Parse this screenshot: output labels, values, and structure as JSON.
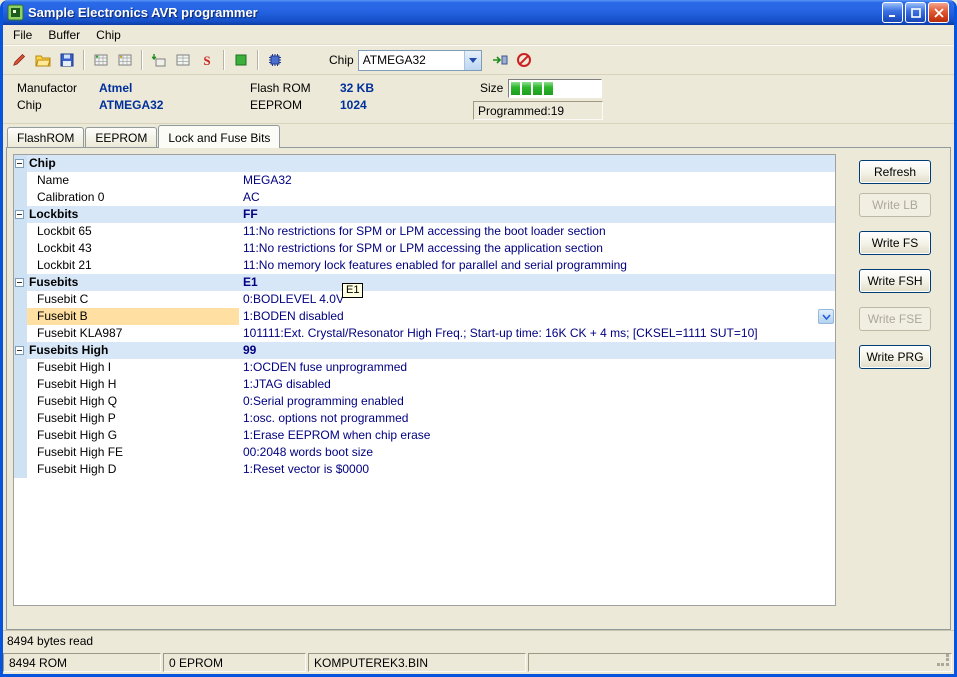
{
  "window": {
    "title": "Sample Electronics AVR programmer"
  },
  "menu": {
    "items": [
      "File",
      "Buffer",
      "Chip"
    ]
  },
  "toolbar": {
    "chip_label": "Chip",
    "chip_select": "ATMEGA32",
    "icons": [
      "pencil-icon",
      "open-file-icon",
      "save-icon",
      "flash-grid-icon",
      "eeprom-grid-icon",
      "write-flash-icon",
      "write-eeprom-icon",
      "erase-chip-icon",
      "verify-icon",
      "chip-icon",
      "program-chip-icon",
      "cancel-icon"
    ]
  },
  "info": {
    "manufactor_label": "Manufactor",
    "manufactor_value": "Atmel",
    "chip_label": "Chip",
    "chip_value": "ATMEGA32",
    "flashrom_label": "Flash ROM",
    "flashrom_value": "32 KB",
    "eeprom_label": "EEPROM",
    "eeprom_value": "1024",
    "size_label": "Size",
    "programmed_label": "Programmed:19",
    "progress_percent": 19,
    "progress_blocks": 4
  },
  "tabs": [
    {
      "label": "FlashROM",
      "active": false
    },
    {
      "label": "EEPROM",
      "active": false
    },
    {
      "label": "Lock and Fuse Bits",
      "active": true
    }
  ],
  "grid": {
    "tooltip": "E1",
    "rows": [
      {
        "type": "group",
        "label": "Chip",
        "value": ""
      },
      {
        "type": "item",
        "label": "Name",
        "value": "MEGA32"
      },
      {
        "type": "item",
        "label": "Calibration 0",
        "value": "AC"
      },
      {
        "type": "group",
        "label": "Lockbits",
        "value": "FF"
      },
      {
        "type": "item",
        "label": "Lockbit 65",
        "value": "11:No restrictions for SPM or LPM accessing the boot loader section"
      },
      {
        "type": "item",
        "label": "Lockbit 43",
        "value": "11:No restrictions for SPM or LPM accessing the application section"
      },
      {
        "type": "item",
        "label": "Lockbit 21",
        "value": "11:No memory lock features enabled for parallel and serial programming"
      },
      {
        "type": "group",
        "label": "Fusebits",
        "value": "E1"
      },
      {
        "type": "item",
        "label": "Fusebit C",
        "value": "0:BODLEVEL 4.0V"
      },
      {
        "type": "item",
        "label": "Fusebit B",
        "value": "1:BODEN disabled",
        "selected": true,
        "dropdown": true
      },
      {
        "type": "item",
        "label": "Fusebit KLA987",
        "value": "101111:Ext. Crystal/Resonator High Freq.; Start-up time: 16K CK + 4 ms; [CKSEL=1111 SUT=10]"
      },
      {
        "type": "group",
        "label": "Fusebits High",
        "value": "99"
      },
      {
        "type": "item",
        "label": "Fusebit High I",
        "value": "1:OCDEN fuse unprogrammed"
      },
      {
        "type": "item",
        "label": "Fusebit High H",
        "value": "1:JTAG disabled"
      },
      {
        "type": "item",
        "label": "Fusebit High Q",
        "value": "0:Serial programming enabled"
      },
      {
        "type": "item",
        "label": "Fusebit High P",
        "value": "1:osc. options not programmed"
      },
      {
        "type": "item",
        "label": "Fusebit High G",
        "value": "1:Erase EEPROM when chip erase"
      },
      {
        "type": "item",
        "label": "Fusebit High FE",
        "value": "00:2048 words boot size"
      },
      {
        "type": "item",
        "label": "Fusebit High D",
        "value": "1:Reset vector is $0000"
      }
    ]
  },
  "side_buttons": [
    {
      "label": "Refresh",
      "enabled": true
    },
    {
      "label": "Write LB",
      "enabled": false
    },
    {
      "label": "Write FS",
      "enabled": true
    },
    {
      "label": "Write FSH",
      "enabled": true
    },
    {
      "label": "Write FSE",
      "enabled": false
    },
    {
      "label": "Write PRG",
      "enabled": true
    }
  ],
  "status_line": "8494 bytes read",
  "status_bar": {
    "panels": [
      "8494 ROM",
      "0 EPROM",
      "KOMPUTEREK3.BIN",
      ""
    ]
  },
  "colors": {
    "titlebar_blue": "#2563e2",
    "value_navy": "#000080",
    "selected_row": "#ffe0a2",
    "group_row": "#d7e7f7",
    "progress_green": "#2eb82e"
  }
}
